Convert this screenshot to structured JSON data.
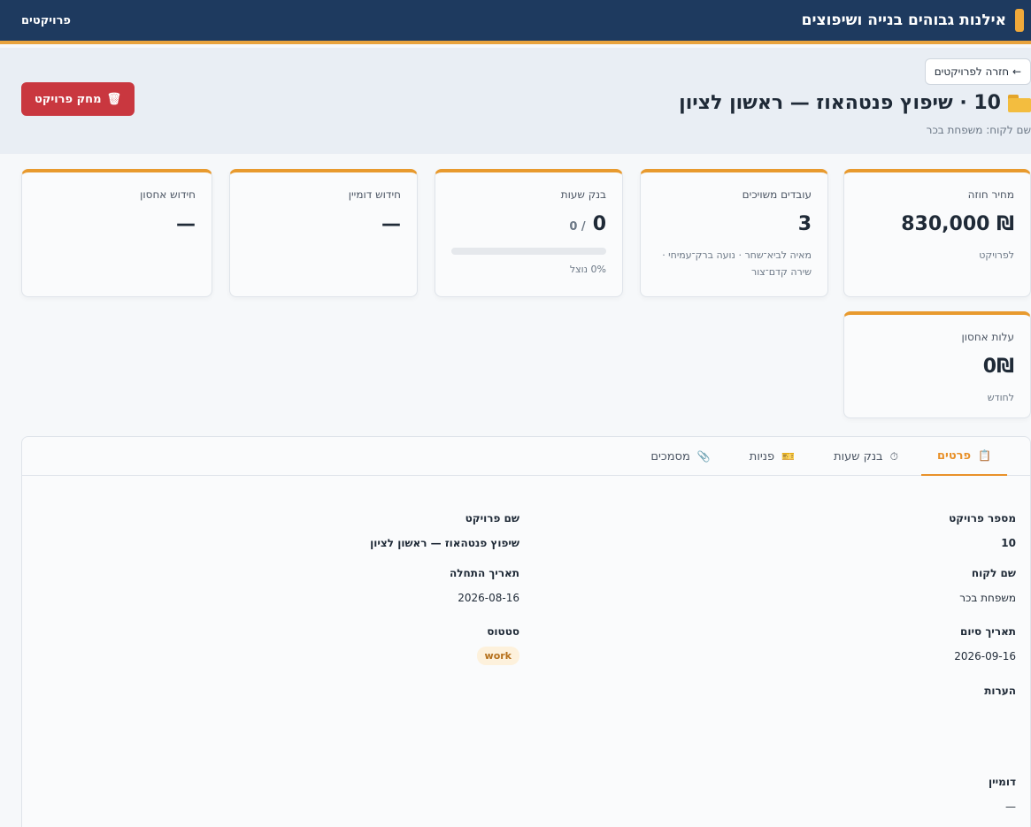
{
  "topbar": {
    "brand_title": "אילנות גבוהים בנייה ושיפוצים",
    "nav_projects": "פרויקטים"
  },
  "header": {
    "back_label": "← חזרה לפרויקטים",
    "title": "10 · שיפוץ פנטהאוז — ראשון לציון",
    "client_line": "שם לקוח: משפחת בכר",
    "delete_label": "מחק פרויקט"
  },
  "cards": {
    "contract_price": {
      "label": "מחיר חוזה",
      "value": "₪ 830,000",
      "sub": "לפרויקט"
    },
    "workers": {
      "label": "עובדים משויכים",
      "value": "3",
      "sub": "מאיה לביא־שחר · נועה ברק־עמיחי · שירה קדם־צור"
    },
    "hours_bank": {
      "label": "בנק שעות",
      "used": "0",
      "total": "/ 0",
      "used_percent": 0,
      "sub": "0% נוצל"
    },
    "domain_renewal": {
      "label": "חידוש דומיין",
      "value": "—"
    },
    "storage_renewal": {
      "label": "חידוש אחסון",
      "value": "—"
    },
    "storage_cost": {
      "label": "עלות אחסון",
      "value": "0₪",
      "sub": "לחודש"
    }
  },
  "tabs": [
    {
      "label": "פרטים",
      "icon": "clipboard-icon",
      "glyph": "📋"
    },
    {
      "label": "בנק שעות",
      "icon": "stopwatch-icon",
      "glyph": "⏱"
    },
    {
      "label": "פניות",
      "icon": "ticket-icon",
      "glyph": "🎫"
    },
    {
      "label": "מסמכים",
      "icon": "paperclip-icon",
      "glyph": "📎"
    }
  ],
  "details": {
    "project_number_label": "מספר פרויקט",
    "project_number": "10",
    "project_name_label": "שם פרויקט",
    "project_name": "שיפוץ פנטהאוז — ראשון לציון",
    "client_name_label": "שם לקוח",
    "client_name": "משפחת בכר",
    "start_date_label": "תאריך התחלה",
    "start_date": "2026-08-16",
    "end_date_label": "תאריך סיום",
    "end_date": "2026-09-16",
    "status_label": "סטטוס",
    "status": "work",
    "notes_label": "הערות",
    "domain_label": "דומיין",
    "domain": "—"
  },
  "colors": {
    "topbar": "#1e3a5f",
    "accent": "#e89a2e",
    "danger": "#c9373f"
  }
}
